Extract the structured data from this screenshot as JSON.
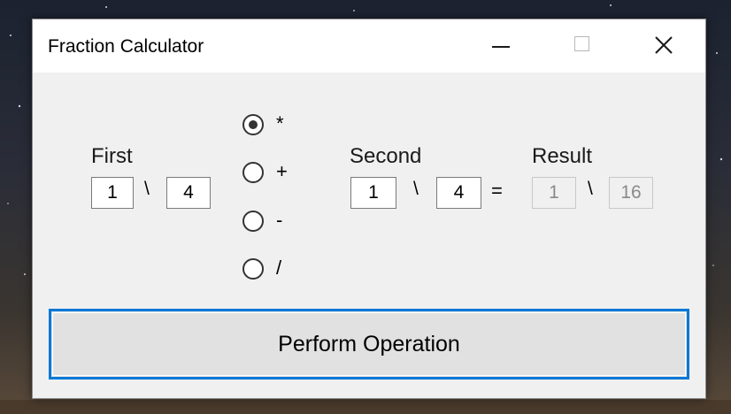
{
  "window": {
    "title": "Fraction Calculator",
    "controls": [
      "minimize-icon",
      "maximize-icon",
      "close-icon"
    ]
  },
  "first": {
    "label": "First",
    "numerator": "1",
    "separator": "\\",
    "denominator": "4"
  },
  "operations": [
    {
      "label": "*",
      "selected": true
    },
    {
      "label": "+",
      "selected": false
    },
    {
      "label": "-",
      "selected": false
    },
    {
      "label": "/",
      "selected": false
    }
  ],
  "second": {
    "label": "Second",
    "numerator": "1",
    "separator": "\\",
    "denominator": "4"
  },
  "equals": "=",
  "result": {
    "label": "Result",
    "numerator": "1",
    "separator": "\\",
    "denominator": "16"
  },
  "perform_button": "Perform Operation",
  "colors": {
    "accent": "#0078d7",
    "window_bg": "#f0f0f0",
    "titlebar_bg": "#ffffff"
  }
}
